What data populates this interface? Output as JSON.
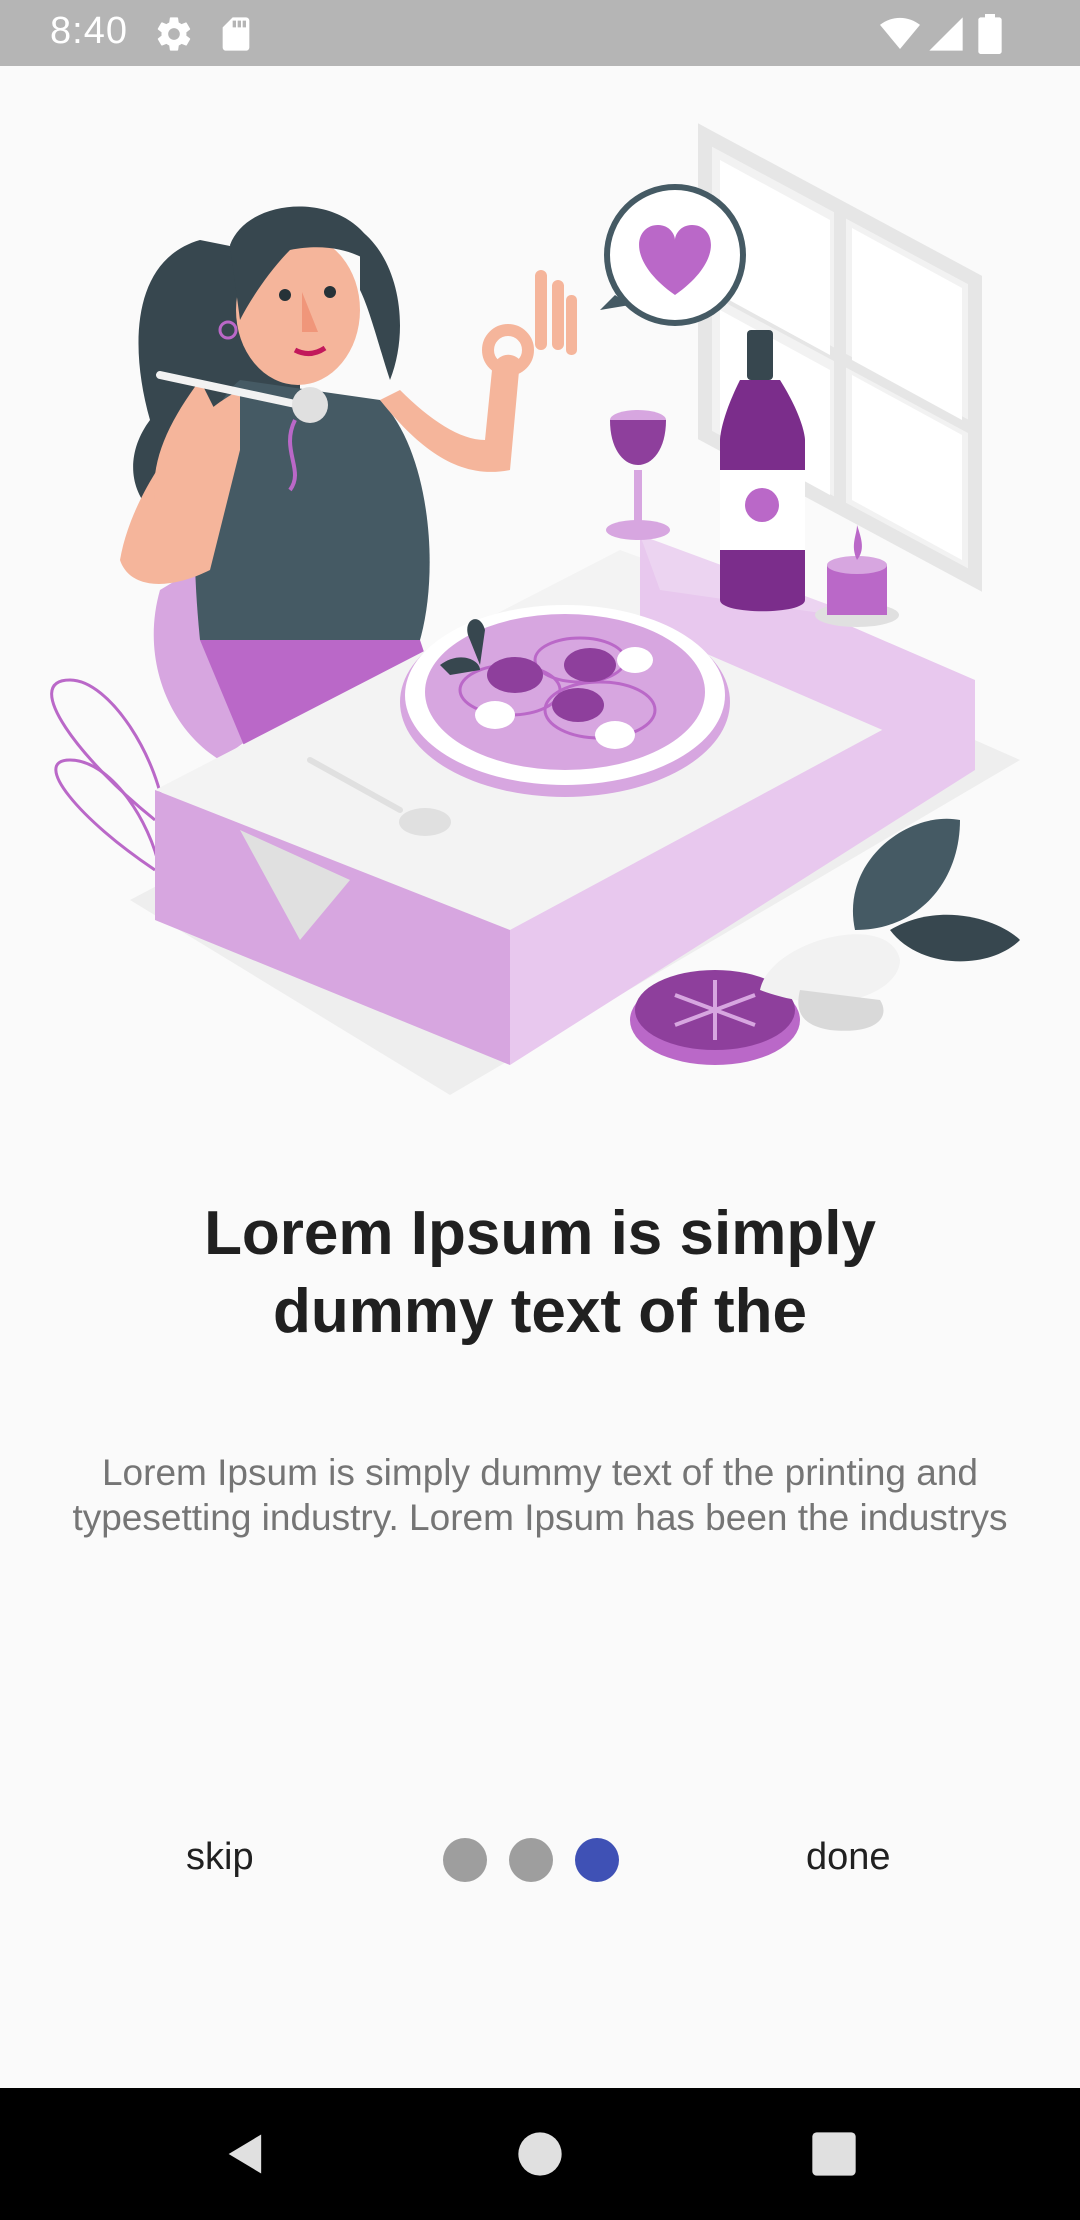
{
  "status_bar": {
    "time": "8:40",
    "left_icons": [
      "settings-gear-icon",
      "sd-card-icon"
    ],
    "right_icons": [
      "wifi-icon",
      "cell-signal-icon",
      "battery-icon"
    ],
    "background": "#b5b5b5"
  },
  "onboarding": {
    "illustration": "woman-dining-illustration",
    "title": "Lorem Ipsum is simply dummy text of the",
    "body": "Lorem Ipsum is simply dummy text of the printing and typesetting industry. Lorem Ipsum has been the industrys",
    "skip_label": "skip",
    "done_label": "done",
    "page_indicator": {
      "total": 3,
      "current": 3
    },
    "colors": {
      "accent": "#3f51b5",
      "inactive_dot": "#9e9e9e",
      "illustration_purple": "#ba68c8"
    }
  },
  "nav_bar": {
    "buttons": [
      "back-icon",
      "home-icon",
      "recents-icon"
    ]
  }
}
